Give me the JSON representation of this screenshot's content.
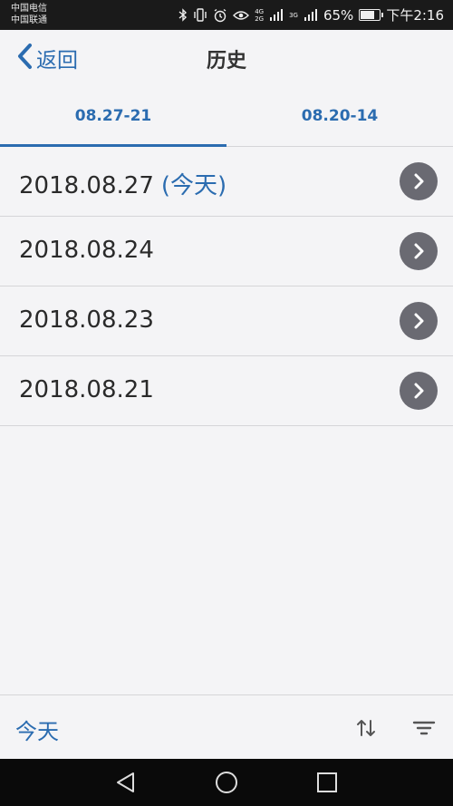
{
  "status_bar": {
    "carrier_1": "中国电信",
    "carrier_2": "中国联通",
    "net_1": "4G\n2G",
    "net_2": "3G",
    "battery": "65%",
    "battery_level": 0.65,
    "time": "下午2:16",
    "icons": [
      "bluetooth-icon",
      "vibrate-icon",
      "alarm-icon",
      "eye-icon",
      "signal-icon"
    ]
  },
  "nav": {
    "back_label": "返回",
    "title": "历史"
  },
  "tabs": [
    {
      "label": "08.27-21",
      "selected": true
    },
    {
      "label": "08.20-14",
      "selected": false
    }
  ],
  "list": [
    {
      "date": "2018.08.27",
      "suffix": "(今天)"
    },
    {
      "date": "2018.08.24",
      "suffix": ""
    },
    {
      "date": "2018.08.23",
      "suffix": ""
    },
    {
      "date": "2018.08.21",
      "suffix": ""
    }
  ],
  "toolbar": {
    "today_label": "今天",
    "icons": [
      "sort-icon",
      "filter-icon"
    ]
  },
  "colors": {
    "accent": "#2b6cb0",
    "chevron_bg": "#6a6a72",
    "background": "#f4f4f6"
  }
}
